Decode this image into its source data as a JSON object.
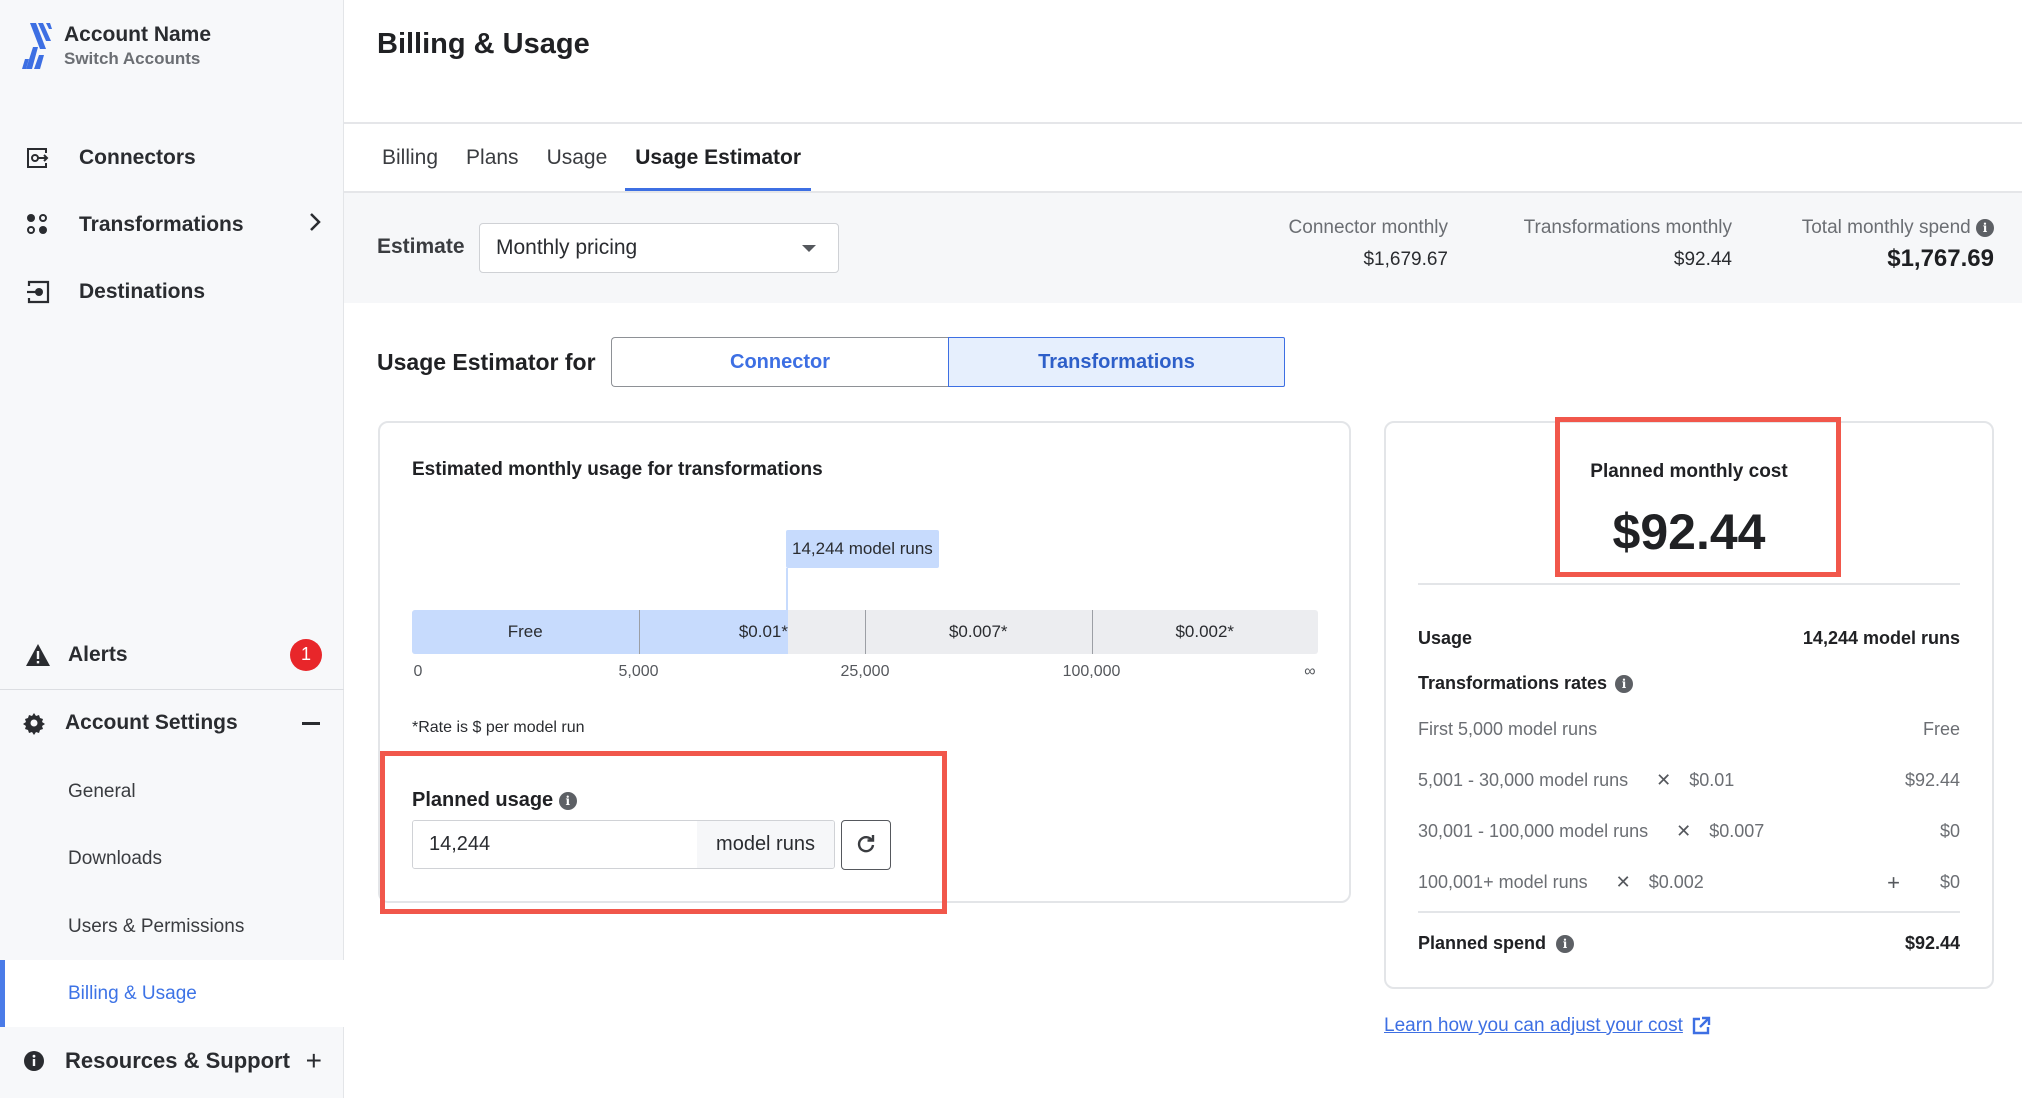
{
  "account": {
    "name": "Account Name",
    "switch_label": "Switch Accounts"
  },
  "sidebar": {
    "items": [
      {
        "label": "Connectors",
        "icon": "connector-icon"
      },
      {
        "label": "Transformations",
        "icon": "transformations-icon",
        "has_chevron": true
      },
      {
        "label": "Destinations",
        "icon": "destination-icon"
      }
    ],
    "alerts": {
      "label": "Alerts",
      "icon": "warning-icon",
      "badge": "1"
    },
    "account_settings": {
      "label": "Account Settings",
      "icon": "gear-icon",
      "expanded": true,
      "children": [
        {
          "label": "General"
        },
        {
          "label": "Downloads"
        },
        {
          "label": "Users & Permissions"
        },
        {
          "label": "Billing & Usage",
          "active": true
        }
      ]
    },
    "resources": {
      "label": "Resources & Support",
      "icon": "info-icon"
    }
  },
  "header": {
    "title": "Billing & Usage"
  },
  "tabs": [
    {
      "label": "Billing"
    },
    {
      "label": "Plans"
    },
    {
      "label": "Usage"
    },
    {
      "label": "Usage Estimator",
      "active": true
    }
  ],
  "estimate": {
    "label": "Estimate",
    "selected": "Monthly pricing",
    "summary": {
      "connector_label": "Connector monthly",
      "connector_value": "$1,679.67",
      "transformations_label": "Transformations monthly",
      "transformations_value": "$92.44",
      "total_label": "Total monthly spend",
      "total_value": "$1,767.69"
    }
  },
  "estimator_for": {
    "label": "Usage Estimator for",
    "options": [
      {
        "label": "Connector"
      },
      {
        "label": "Transformations",
        "selected": true
      }
    ]
  },
  "usage_card": {
    "title": "Estimated monthly usage for transformations",
    "marker_label": "14,244 model runs",
    "rate_note": "*Rate is $ per model run",
    "planned_usage_label": "Planned usage",
    "planned_usage_value": "14,244",
    "planned_usage_unit": "model runs"
  },
  "chart_data": {
    "type": "bar",
    "title": "Estimated monthly usage for transformations",
    "tiers": [
      {
        "label": "Free",
        "from": "0",
        "to": "5,000"
      },
      {
        "label": "$0.01*",
        "from": "5,000",
        "to": "25,000"
      },
      {
        "label": "$0.007*",
        "from": "25,000",
        "to": "100,000"
      },
      {
        "label": "$0.002*",
        "from": "100,000",
        "to": "∞"
      }
    ],
    "tick_labels": [
      "0",
      "5,000",
      "25,000",
      "100,000",
      "∞"
    ],
    "marker": {
      "value": 14244,
      "label": "14,244 model runs"
    },
    "marker_fraction_of_tier_2": 0.66
  },
  "cost_card": {
    "title": "Planned monthly cost",
    "value": "$92.44",
    "usage_label": "Usage",
    "usage_value": "14,244 model runs",
    "rates_label": "Transformations rates",
    "rates": [
      {
        "range": "First 5,000 model runs",
        "rate": "",
        "amount": "Free"
      },
      {
        "range": "5,001 - 30,000 model runs",
        "rate": "$0.01",
        "amount": "$92.44"
      },
      {
        "range": "30,001 - 100,000 model runs",
        "rate": "$0.007",
        "amount": "$0"
      },
      {
        "range": "100,001+ model runs",
        "rate": "$0.002",
        "amount": "$0",
        "plus": true
      }
    ],
    "planned_spend_label": "Planned spend",
    "planned_spend_value": "$92.44"
  },
  "learn_link": "Learn how you can adjust your cost",
  "colors": {
    "accent": "#3d6fe3",
    "highlight_box": "#f1574b",
    "alert_badge": "#e8262a",
    "fill": "#c7dbfd"
  }
}
